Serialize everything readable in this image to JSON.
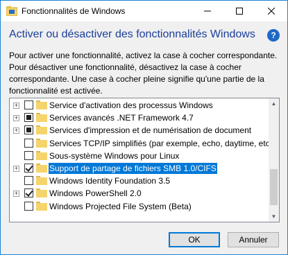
{
  "window": {
    "title": "Fonctionnalités de Windows",
    "caption_buttons": {
      "minimize": "—",
      "maximize": "☐",
      "close": "✕"
    }
  },
  "header": {
    "title": "Activer ou désactiver des fonctionnalités Windows",
    "help": "?"
  },
  "description": "Pour activer une fonctionnalité, activez la case à cocher correspondante. Pour désactiver une fonctionnalité, désactivez la case à cocher correspondante. Une case à cocher pleine signifie qu'une partie de la fonctionnalité est activée.",
  "features": [
    {
      "label": "Service d'activation des processus Windows",
      "expander": "+",
      "state": "unchecked",
      "selected": false
    },
    {
      "label": "Services avancés .NET Framework 4.7",
      "expander": "+",
      "state": "partial",
      "selected": false
    },
    {
      "label": "Services d'impression et de numérisation de document",
      "expander": "+",
      "state": "partial",
      "selected": false
    },
    {
      "label": "Services TCP/IP simplifiés (par exemple, echo, daytime, etc.)",
      "expander": "",
      "state": "unchecked",
      "selected": false
    },
    {
      "label": "Sous-système Windows pour Linux",
      "expander": "",
      "state": "unchecked",
      "selected": false
    },
    {
      "label": "Support de partage de fichiers SMB 1.0/CIFS",
      "expander": "+",
      "state": "checked",
      "selected": true
    },
    {
      "label": "Windows Identity Foundation 3.5",
      "expander": "",
      "state": "unchecked",
      "selected": false
    },
    {
      "label": "Windows PowerShell 2.0",
      "expander": "+",
      "state": "checked",
      "selected": false
    },
    {
      "label": "Windows Projected File System (Beta)",
      "expander": "",
      "state": "unchecked",
      "selected": false
    }
  ],
  "buttons": {
    "ok": "OK",
    "cancel": "Annuler"
  },
  "colors": {
    "accent": "#0078d7",
    "header": "#1a3e9b",
    "folder": "#f5d46b"
  }
}
